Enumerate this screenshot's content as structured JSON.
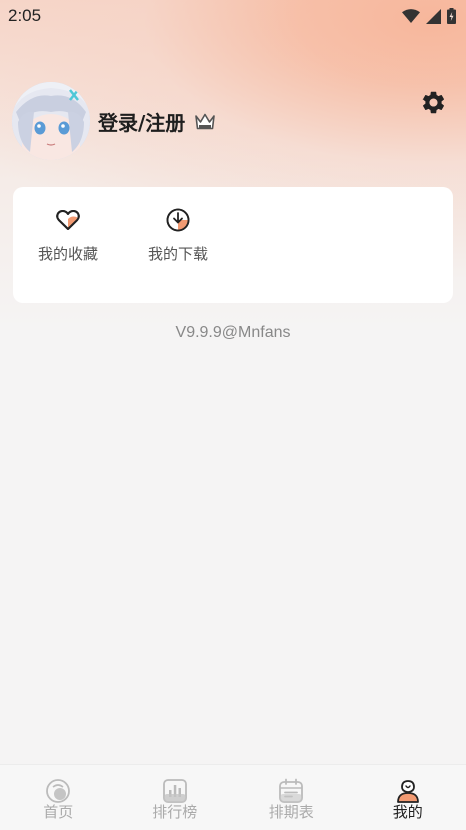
{
  "status_bar": {
    "time": "2:05"
  },
  "profile": {
    "login_label": "登录/注册"
  },
  "card": {
    "items": [
      {
        "label": "我的收藏",
        "icon": "heart-icon"
      },
      {
        "label": "我的下载",
        "icon": "download-icon"
      }
    ]
  },
  "version": "V9.9.9@Mnfans",
  "tabbar": {
    "tabs": [
      {
        "label": "首页",
        "icon": "home-icon",
        "active": false
      },
      {
        "label": "排行榜",
        "icon": "ranking-icon",
        "active": false
      },
      {
        "label": "排期表",
        "icon": "schedule-icon",
        "active": false
      },
      {
        "label": "我的",
        "icon": "profile-icon",
        "active": true
      }
    ]
  },
  "colors": {
    "accent": "#f19a72",
    "text_dark": "#222222",
    "tab_inactive": "#aaaaaa"
  }
}
